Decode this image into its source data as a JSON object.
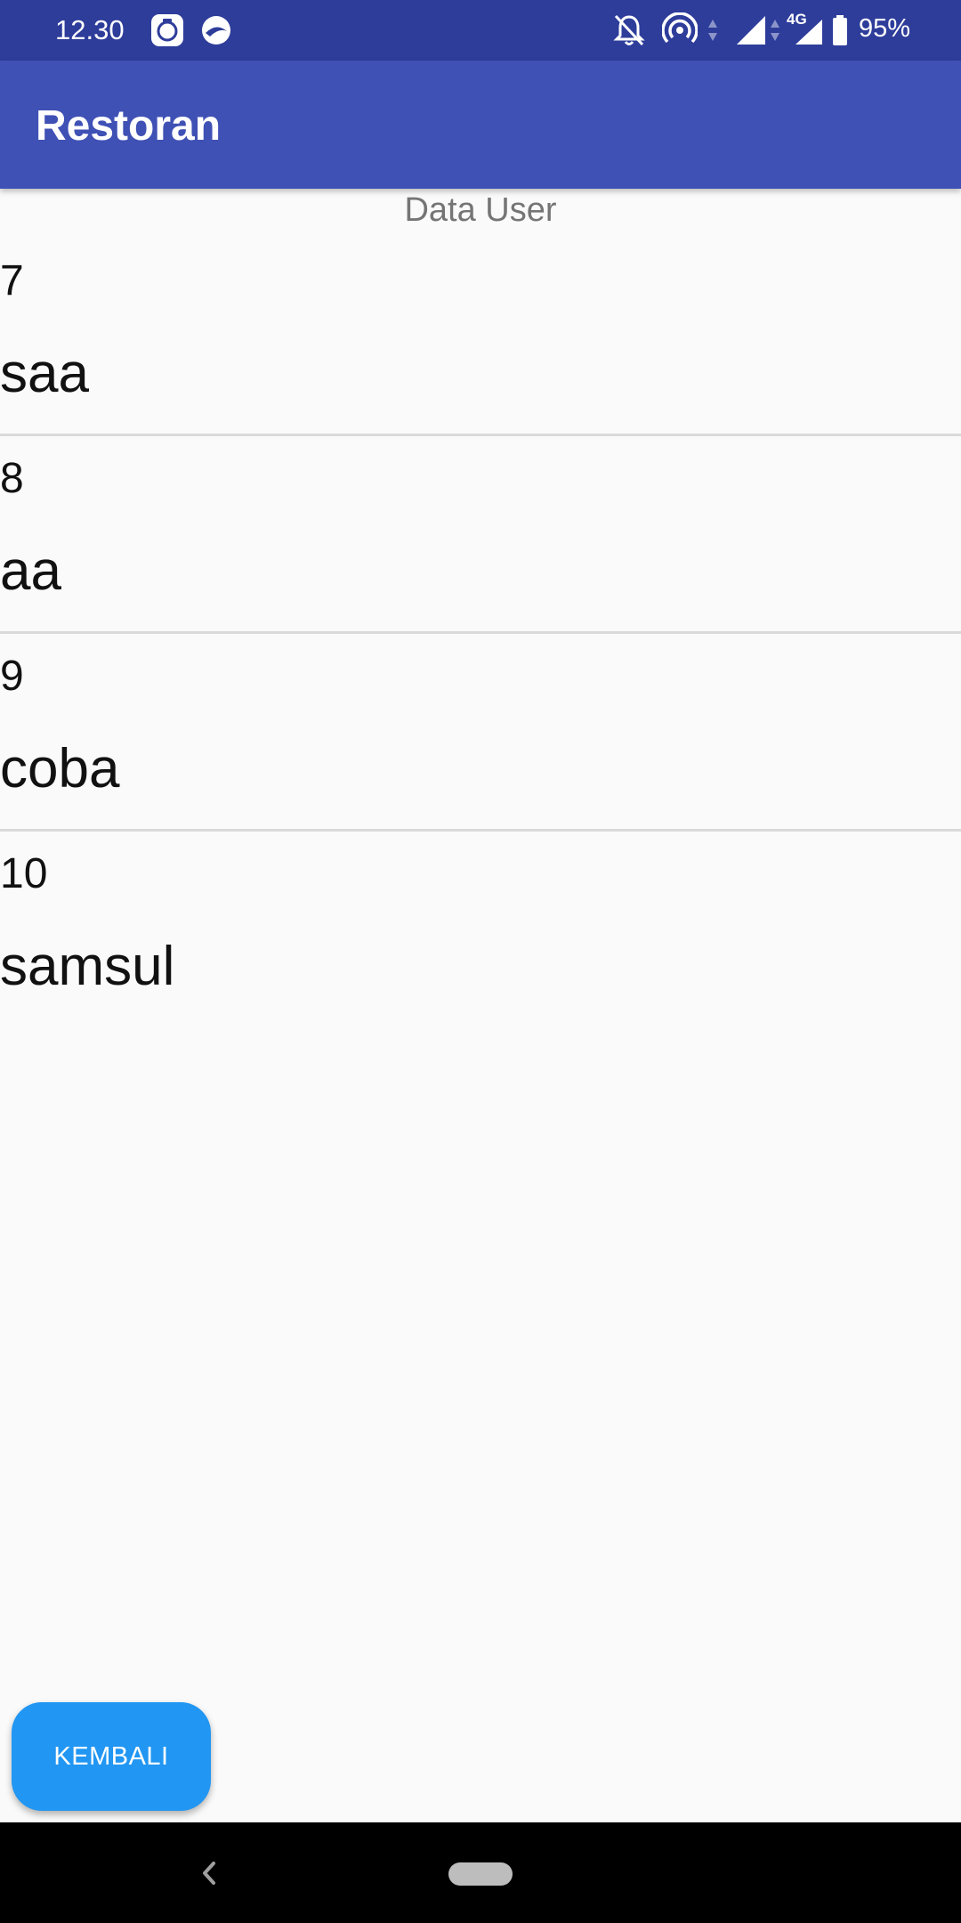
{
  "status_bar": {
    "time": "12.30",
    "battery_percent": "95%",
    "network_label": "4G",
    "icons": [
      "app-notification-icon",
      "browser-notification-icon",
      "bell-off-icon",
      "hotspot-icon",
      "signal-icon",
      "battery-icon"
    ]
  },
  "app_bar": {
    "title": "Restoran"
  },
  "main": {
    "heading": "Data User",
    "users": [
      {
        "id": "7",
        "name": "saa"
      },
      {
        "id": "8",
        "name": "aa"
      },
      {
        "id": "9",
        "name": "coba"
      },
      {
        "id": "10",
        "name": "samsul"
      }
    ]
  },
  "actions": {
    "back_label": "KEMBALI"
  },
  "colors": {
    "status_bar": "#2e3d9a",
    "app_bar": "#3f51b5",
    "button": "#2196f3",
    "background": "#fafafa"
  }
}
